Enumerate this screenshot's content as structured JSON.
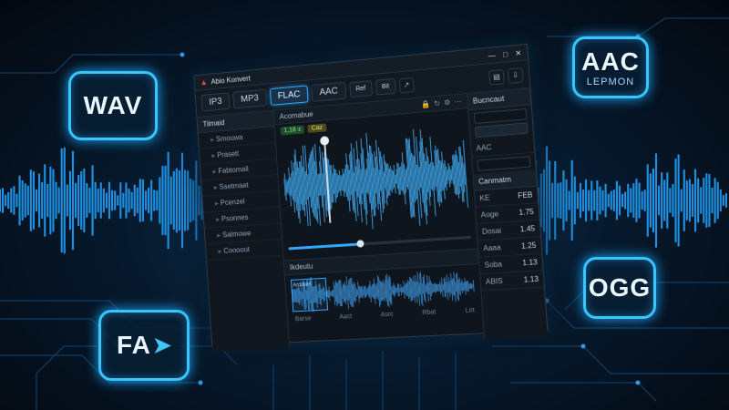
{
  "badges": {
    "wav": {
      "label": "WAV"
    },
    "aac": {
      "label": "AAC",
      "sub": "LEPMON"
    },
    "ogg": {
      "label": "OGG"
    },
    "fa": {
      "label": "FA"
    }
  },
  "window": {
    "title": "Abio Konvert",
    "controls": [
      "—",
      "□",
      "✕"
    ],
    "tabs": [
      {
        "label": "IP3",
        "active": false
      },
      {
        "label": "MP3",
        "active": false
      },
      {
        "label": "FLAC",
        "active": true
      },
      {
        "label": "AAC",
        "active": false
      },
      {
        "label": "Ref",
        "active": false
      },
      {
        "label": "Bit",
        "active": false
      }
    ],
    "sidebar": {
      "title": "Tilmaid",
      "items": [
        "Smouwa",
        "Prasett",
        "Fabtomail",
        "Ssetmaat",
        "Pcenzel",
        "Psonnes",
        "Salmowe",
        "Coooout"
      ]
    },
    "editor": {
      "title": "Acomabue",
      "chips": [
        "1,18 ±",
        "Caz"
      ],
      "overview_title": "Ikdeutu",
      "overview_tag": "Ardiruel",
      "timeline": [
        "Barse",
        "Aact",
        "Asrc",
        "Rbat",
        "Lot"
      ]
    },
    "settings": {
      "title": "Bucncaut",
      "format_label": "AAC",
      "content_title": "Canmatm",
      "rows": [
        {
          "label": "KE",
          "value": "FEB"
        },
        {
          "label": "Aoge",
          "value": "1.75"
        },
        {
          "label": "Dosai",
          "value": "1.45"
        },
        {
          "label": "Aaaa",
          "value": "1.25"
        },
        {
          "label": "Soba",
          "value": "1.13"
        },
        {
          "label": "ABIS",
          "value": "1.13"
        }
      ]
    }
  },
  "colors": {
    "accent": "#2fa8ff",
    "glow": "#39c6ff",
    "background": "#03080f"
  }
}
